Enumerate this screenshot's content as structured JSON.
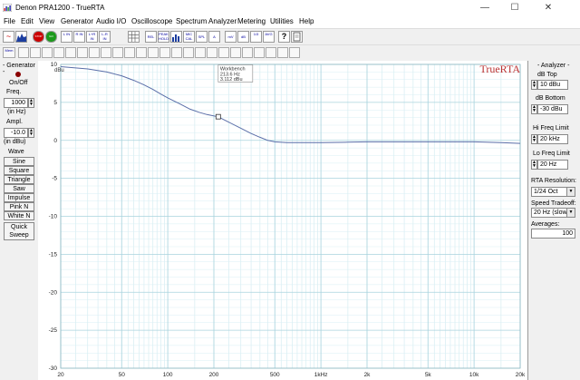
{
  "window": {
    "title": "Denon PRA1200 - TrueRTA",
    "minimize": "—",
    "maximize": "☐",
    "close": "✕"
  },
  "menu": [
    "File",
    "Edit",
    "View",
    "Generator",
    "Audio I/O",
    "Oscilloscope",
    "Spectrum Analyzer",
    "Metering",
    "Utilities",
    "Help"
  ],
  "toolbar": {
    "buttons": [
      {
        "name": "sine-wave-button",
        "label": "~"
      },
      {
        "name": "spectrum-button",
        "label": ""
      },
      {
        "name": "stop-button",
        "label": "STOP"
      },
      {
        "name": "go-button",
        "label": "GO"
      },
      {
        "name": "l-in-button",
        "label": "L IN"
      },
      {
        "name": "r-in-button",
        "label": "R IN"
      },
      {
        "name": "lr-in-button",
        "label": "L+R IN"
      },
      {
        "name": "lr-diff-button",
        "label": "L-R IN"
      },
      {
        "name": "grid-button",
        "label": ""
      },
      {
        "name": "rel-button",
        "label": "REL"
      },
      {
        "name": "peak-hold-button",
        "label": "PEAK HOLD"
      },
      {
        "name": "bars-button",
        "label": ""
      },
      {
        "name": "mic-cal-button",
        "label": "MIC CAL"
      },
      {
        "name": "spl-button",
        "label": "SPL"
      },
      {
        "name": "weighting-button",
        "label": "A"
      },
      {
        "name": "mv-button",
        "label": "mV"
      },
      {
        "name": "db-button",
        "label": "dB"
      },
      {
        "name": "oct-button",
        "label": "1/3"
      },
      {
        "name": "avg-button",
        "label": "AVG"
      },
      {
        "name": "help-button",
        "label": "?"
      },
      {
        "name": "info-button",
        "label": ""
      }
    ],
    "mem_label": "Mem"
  },
  "generator": {
    "title": "- Generator -",
    "on_off": "On/Off",
    "freq_label": "Freq.",
    "freq_value": "1000",
    "freq_unit": "(in Hz)",
    "ampl_label": "Ampl.",
    "ampl_value": "-10.0",
    "ampl_unit": "(in dBu)",
    "wave_label": "Wave",
    "waves": [
      "Sine",
      "Square",
      "Triangle",
      "Saw",
      "Impulse",
      "Pink N",
      "White N"
    ],
    "quick": "Quick",
    "sweep": "Sweep"
  },
  "analyzer": {
    "title": "- Analyzer -",
    "db_top_label": "dB Top",
    "db_top_value": "10 dBu",
    "db_bottom_label": "dB Bottom",
    "db_bottom_value": "-30 dBu",
    "hi_freq_label": "Hi Freq Limit",
    "hi_freq_value": "20 kHz",
    "lo_freq_label": "Lo Freq Limit",
    "lo_freq_value": "20 Hz",
    "rta_res_label": "RTA Resolution:",
    "rta_res_value": "1/24 Oct",
    "speed_label": "Speed Tradeoff:",
    "speed_value": "20 Hz (slow)",
    "averages_label": "Averages:",
    "averages_value": "100"
  },
  "chart_data": {
    "type": "line",
    "xscale": "log",
    "xlim": [
      20,
      20000
    ],
    "ylim": [
      -30,
      10
    ],
    "ylabel": "dBu",
    "watermark": "TrueRTA",
    "x_ticks": [
      {
        "v": 20,
        "label": "20"
      },
      {
        "v": 50,
        "label": "50"
      },
      {
        "v": 100,
        "label": "100"
      },
      {
        "v": 200,
        "label": "200"
      },
      {
        "v": 500,
        "label": "500"
      },
      {
        "v": 1000,
        "label": "1kHz"
      },
      {
        "v": 2000,
        "label": "2k"
      },
      {
        "v": 5000,
        "label": "5k"
      },
      {
        "v": 10000,
        "label": "10k"
      },
      {
        "v": 20000,
        "label": "20k"
      }
    ],
    "y_ticks": [
      10,
      5,
      0,
      -5,
      -10,
      -15,
      -20,
      -25,
      -30
    ],
    "grid": true,
    "series": [
      {
        "name": "Workbench",
        "color": "#5a6ea8",
        "points": [
          [
            20,
            9.7
          ],
          [
            30,
            9.4
          ],
          [
            40,
            9.0
          ],
          [
            50,
            8.5
          ],
          [
            60,
            7.9
          ],
          [
            70,
            7.3
          ],
          [
            80,
            6.7
          ],
          [
            90,
            6.1
          ],
          [
            100,
            5.6
          ],
          [
            120,
            4.8
          ],
          [
            140,
            4.1
          ],
          [
            160,
            3.7
          ],
          [
            180,
            3.4
          ],
          [
            213.6,
            3.1
          ],
          [
            250,
            2.4
          ],
          [
            300,
            1.6
          ],
          [
            350,
            0.9
          ],
          [
            400,
            0.4
          ],
          [
            450,
            0.0
          ],
          [
            500,
            -0.2
          ],
          [
            600,
            -0.3
          ],
          [
            700,
            -0.3
          ],
          [
            800,
            -0.3
          ],
          [
            1000,
            -0.3
          ],
          [
            1500,
            -0.25
          ],
          [
            2000,
            -0.2
          ],
          [
            3000,
            -0.2
          ],
          [
            5000,
            -0.2
          ],
          [
            7000,
            -0.2
          ],
          [
            10000,
            -0.2
          ],
          [
            15000,
            -0.3
          ],
          [
            20000,
            -0.4
          ]
        ]
      }
    ],
    "marker": {
      "x": 213.6,
      "y": 3.112,
      "label_title": "Workbench",
      "label_freq": "213.6 Hz",
      "label_level": "3.112 dBu"
    }
  }
}
